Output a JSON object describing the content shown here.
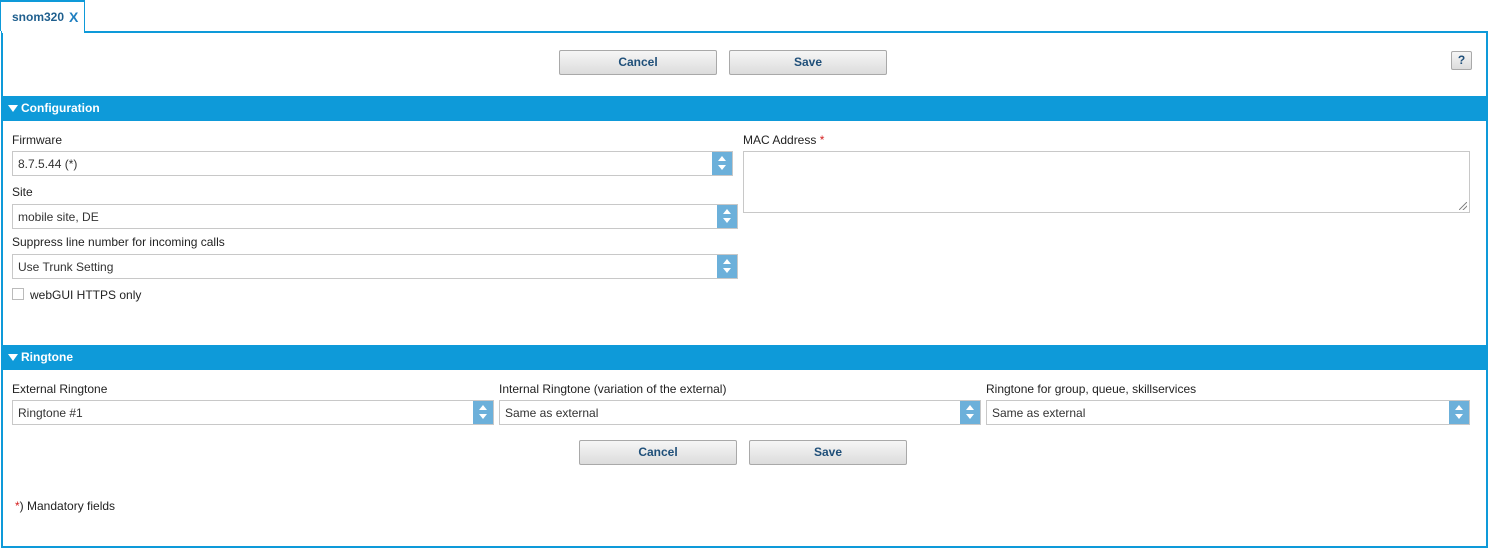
{
  "tab": {
    "label": "snom320",
    "close": "X"
  },
  "toolbar": {
    "cancel_label": "Cancel",
    "save_label": "Save",
    "help_label": "?"
  },
  "configuration": {
    "title": "Configuration",
    "firmware": {
      "label": "Firmware",
      "value": "8.7.5.44 (*)"
    },
    "site": {
      "label": "Site",
      "value": "mobile site, DE"
    },
    "suppress": {
      "label": "Suppress line number for incoming calls",
      "value": "Use Trunk Setting"
    },
    "https_only": {
      "label": "webGUI HTTPS only",
      "checked": false
    },
    "mac": {
      "label": "MAC Address",
      "required": "*",
      "value": ""
    }
  },
  "ringtone": {
    "title": "Ringtone",
    "external": {
      "label": "External Ringtone",
      "value": "Ringtone #1"
    },
    "internal": {
      "label": "Internal Ringtone (variation of the external)",
      "value": "Same as external"
    },
    "group": {
      "label": "Ringtone for group, queue, skillservices",
      "value": "Same as external"
    }
  },
  "footer": {
    "cancel_label": "Cancel",
    "save_label": "Save",
    "mandatory_star": "*",
    "mandatory_text": ") Mandatory fields"
  },
  "colors": {
    "accent": "#0e9ad9",
    "spinner": "#6cb0da",
    "required": "#d42020"
  }
}
